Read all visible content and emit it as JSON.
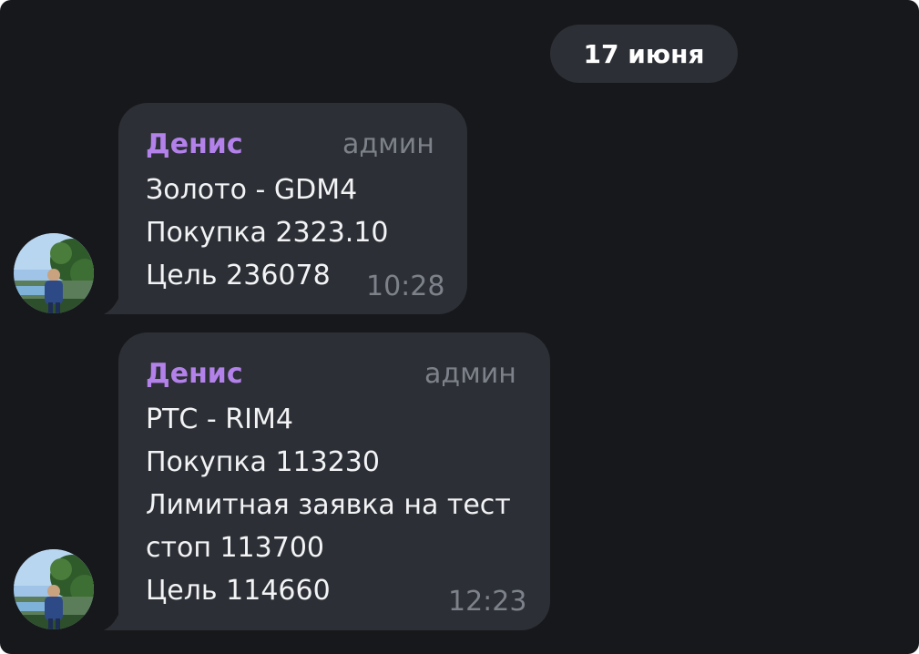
{
  "date_separator": "17 июня",
  "messages": [
    {
      "sender": "Денис",
      "role": "админ",
      "lines": [
        "Золото - GDM4",
        "Покупка 2323.10",
        "Цель 236078"
      ],
      "time": "10:28",
      "avatar_icon": "user-avatar-photo"
    },
    {
      "sender": "Денис",
      "role": "админ",
      "lines": [
        "РТС - RIM4",
        "Покупка 113230",
        "Лимитная заявка на тест",
        "стоп 113700",
        "Цель 114660"
      ],
      "time": "12:23",
      "avatar_icon": "user-avatar-photo"
    }
  ],
  "colors": {
    "background": "#17181c",
    "bubble": "#2c2f35",
    "sender_name": "#b381ea",
    "meta_text": "#7d8189",
    "message_text": "#f2f3f5"
  }
}
